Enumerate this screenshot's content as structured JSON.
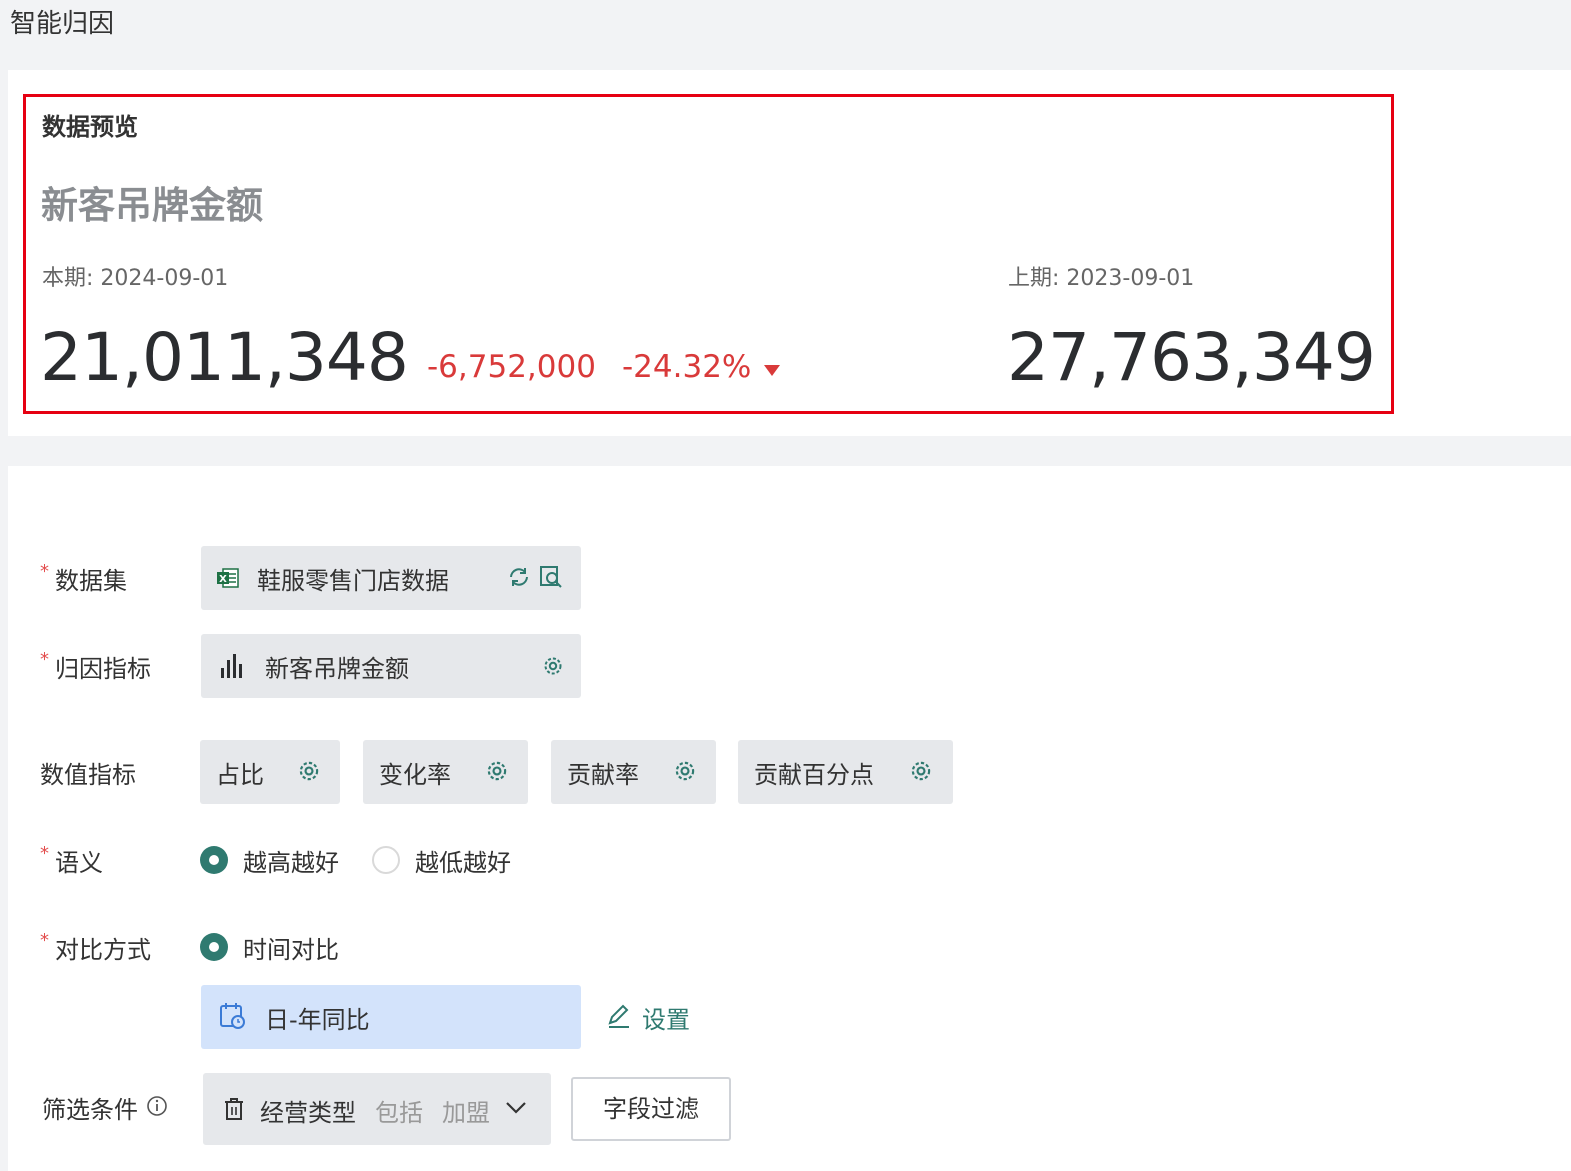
{
  "page": {
    "title": "智能归因"
  },
  "preview": {
    "heading": "数据预览",
    "metric_name": "新客吊牌金额",
    "current": {
      "label": "本期: 2024-09-01",
      "value": "21,011,348"
    },
    "previous": {
      "label": "上期: 2023-09-01",
      "value": "27,763,349"
    },
    "delta_abs": "-6,752,000",
    "delta_pct": "-24.32%",
    "trend": "down"
  },
  "form": {
    "dataset": {
      "label": "数据集",
      "required": true,
      "value": "鞋服零售门店数据",
      "icons": [
        "excel-icon",
        "refresh-icon",
        "preview-icon"
      ]
    },
    "attribution_metric": {
      "label": "归因指标",
      "required": true,
      "value": "新客吊牌金额",
      "icons": [
        "bar-chart-icon",
        "gear-icon"
      ]
    },
    "numeric_metrics": {
      "label": "数值指标",
      "items": [
        {
          "label": "占比"
        },
        {
          "label": "变化率"
        },
        {
          "label": "贡献率"
        },
        {
          "label": "贡献百分点"
        }
      ]
    },
    "semantics": {
      "label": "语义",
      "required": true,
      "options": [
        {
          "label": "越高越好",
          "selected": true
        },
        {
          "label": "越低越好",
          "selected": false
        }
      ]
    },
    "compare": {
      "label": "对比方式",
      "required": true,
      "option": {
        "label": "时间对比",
        "selected": true
      },
      "value": "日-年同比",
      "settings_label": "设置"
    },
    "filter": {
      "label": "筛选条件",
      "field": "经营类型",
      "operator": "包括",
      "value": "加盟",
      "button_label": "字段过滤"
    }
  },
  "colors": {
    "highlight_border": "#e60012",
    "negative": "#d93a3a",
    "accent": "#2f7a70",
    "field_bg": "#e6e8eb",
    "compare_bg": "#d3e3fb"
  }
}
